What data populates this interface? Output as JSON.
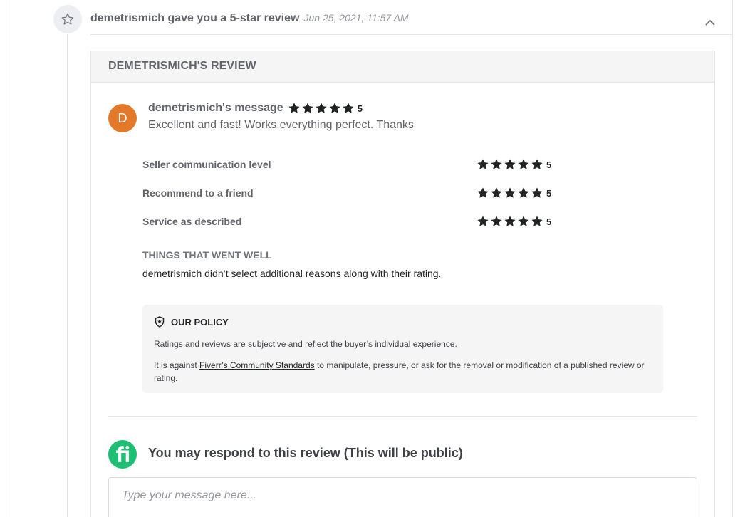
{
  "event": {
    "title": "demetrismich gave you a 5-star review",
    "date": "Jun 25, 2021, 11:57 AM",
    "icon": "star-outline-icon"
  },
  "review": {
    "header": "DEMETRISMICH'S REVIEW",
    "avatar_letter": "D",
    "avatar_color": "#e5792a",
    "message_label": "demetrismich's message",
    "overall_rating": 5,
    "overall_score": "5",
    "message": "Excellent and fast! Works everything perfect. Thanks",
    "ratings": [
      {
        "label": "Seller communication level",
        "stars": 5,
        "score": "5"
      },
      {
        "label": "Recommend to a friend",
        "stars": 5,
        "score": "5"
      },
      {
        "label": "Service as described",
        "stars": 5,
        "score": "5"
      }
    ],
    "went_well_title": "THINGS THAT WENT WELL",
    "went_well_text": "demetrismich didn’t select additional reasons along with their rating."
  },
  "policy": {
    "title": "OUR POLICY",
    "line1": "Ratings and reviews are subjective and reflect the buyer’s individual experience.",
    "line2_before": "It is against ",
    "line2_link": "Fiverr’s Community Standards",
    "line2_after": " to manipulate, pressure, or ask for the removal or modification of a published review or rating."
  },
  "respond": {
    "title": "You may respond to this review (This will be public)",
    "placeholder": "Type your message here...",
    "value": "",
    "logo_color": "#1dbf73"
  }
}
